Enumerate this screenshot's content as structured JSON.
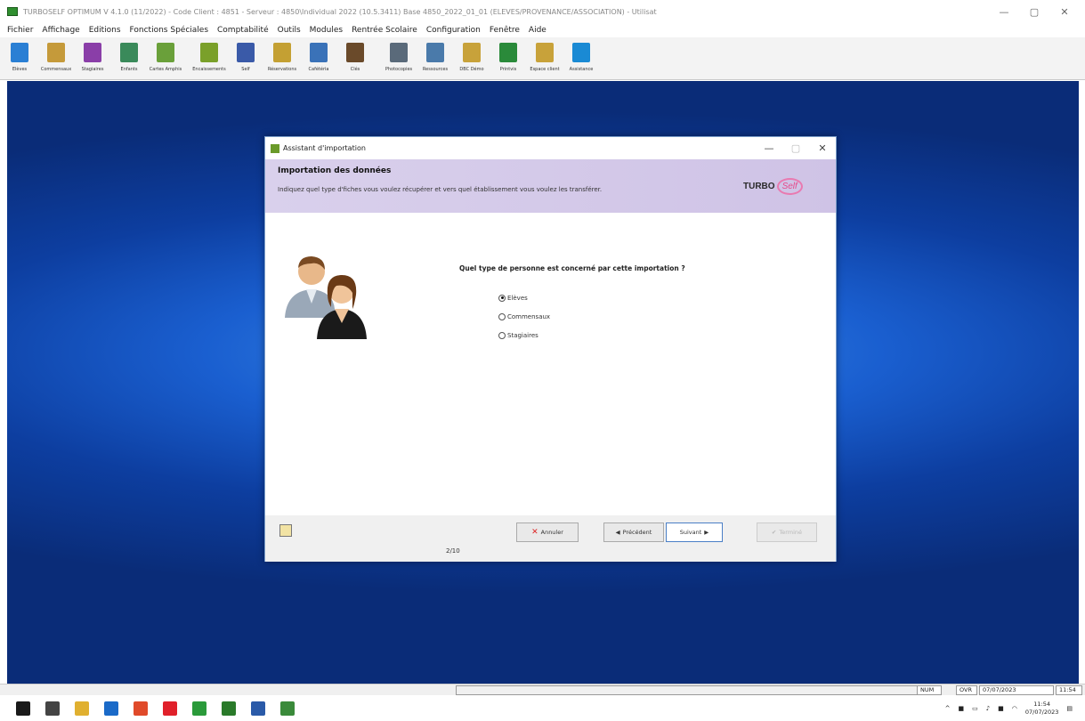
{
  "app": {
    "title": "TURBOSELF OPTIMUM V 4.1.0 (11/2022) - Code Client : 4851 - Serveur : 4850\\Individual 2022 (10.5.3411) Base 4850_2022_01_01 (ELEVES/PROVENANCE/ASSOCIATION) - Utilisat",
    "win_controls": {
      "minimize": "—",
      "maximize": "▢",
      "close": "✕"
    }
  },
  "menu": [
    "Fichier",
    "Affichage",
    "Editions",
    "Fonctions Spéciales",
    "Comptabilité",
    "Outils",
    "Modules",
    "Rentrée Scolaire",
    "Configuration",
    "Fenêtre",
    "Aide"
  ],
  "toolbar": [
    {
      "label": "Elèves",
      "color": "#2a7fd4"
    },
    {
      "label": "Commensaux",
      "color": "#c59a3a"
    },
    {
      "label": "Stagiaires",
      "color": "#8a3ea8"
    },
    {
      "label": "Enfants",
      "color": "#3a8a5a"
    },
    {
      "label": "Cartes Amphis",
      "color": "#6aa03a"
    },
    {
      "label": "Encaissements",
      "color": "#7aa02a"
    },
    {
      "label": "Self",
      "color": "#3a5aa8"
    },
    {
      "label": "Réservations",
      "color": "#c4a033"
    },
    {
      "label": "Cafétéria",
      "color": "#3a72b8"
    },
    {
      "label": "Clés",
      "color": "#6a4a2a"
    },
    {
      "label": "Photocopies",
      "color": "#5a6a7a"
    },
    {
      "label": "Ressources",
      "color": "#4a7aaa"
    },
    {
      "label": "DBC Démo",
      "color": "#c8a23a"
    },
    {
      "label": "Printvis",
      "color": "#2a8a3a"
    },
    {
      "label": "Espace client",
      "color": "#c8a23a"
    },
    {
      "label": "Assistance",
      "color": "#1a8ad4"
    }
  ],
  "dialog": {
    "title": "Assistant d'importation",
    "controls": {
      "minimize": "—",
      "maximize": "▢",
      "close": "✕"
    },
    "header_title": "Importation des données",
    "header_subtitle": "Indiquez quel type d'fiches vous voulez récupérer et vers quel établissement vous voulez les transférer.",
    "logo_main": "TURBO",
    "logo_accent": "Self",
    "question": "Quel type de personne est concerné par cette importation ?",
    "options": [
      {
        "label": "Elèves",
        "selected": true
      },
      {
        "label": "Commensaux",
        "selected": false
      },
      {
        "label": "Stagiaires",
        "selected": false
      }
    ],
    "buttons": {
      "cancel": "Annuler",
      "previous": "Précédent",
      "next": "Suivant",
      "finish": "Terminé"
    },
    "step": "2/10"
  },
  "statusbar": {
    "num": "NUM",
    "ovr": "OVR",
    "date": "07/07/2023",
    "time": "11:54"
  },
  "taskbar": {
    "clock_time": "11:54",
    "clock_date": "07/07/2023",
    "icons": [
      {
        "name": "start-icon",
        "color": "#1a1a1a"
      },
      {
        "name": "task-view-icon",
        "color": "#444"
      },
      {
        "name": "file-explorer-icon",
        "color": "#e0b030"
      },
      {
        "name": "mail-icon",
        "color": "#1a6ac8"
      },
      {
        "name": "chrome-icon",
        "color": "#e04a2a"
      },
      {
        "name": "opera-icon",
        "color": "#e0202a"
      },
      {
        "name": "chrome-2-icon",
        "color": "#2a9a3a"
      },
      {
        "name": "app-icon",
        "color": "#2a7a2a"
      },
      {
        "name": "network-app-icon",
        "color": "#2a5aa8"
      },
      {
        "name": "turboself-icon",
        "color": "#3a8a3a"
      }
    ]
  }
}
